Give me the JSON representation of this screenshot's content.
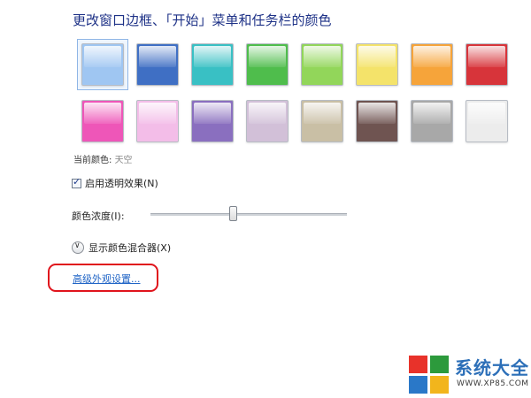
{
  "title": "更改窗口边框、「开始」菜单和任务栏的颜色",
  "swatches": [
    {
      "name": "sky",
      "color": "#9fc6f2",
      "selected": true
    },
    {
      "name": "twilight",
      "color": "#3f6fc4"
    },
    {
      "name": "sea",
      "color": "#39c0c4"
    },
    {
      "name": "leaf",
      "color": "#4fbd4c"
    },
    {
      "name": "lime",
      "color": "#92d65a"
    },
    {
      "name": "sun",
      "color": "#f4e36a"
    },
    {
      "name": "pumpkin",
      "color": "#f6a43a"
    },
    {
      "name": "ruby",
      "color": "#d7343a"
    },
    {
      "name": "fuchsia",
      "color": "#ee56b8"
    },
    {
      "name": "blush",
      "color": "#f3bde8"
    },
    {
      "name": "violet",
      "color": "#8a6fbf"
    },
    {
      "name": "lavender",
      "color": "#d2c0d8"
    },
    {
      "name": "taupe",
      "color": "#c9bfa5"
    },
    {
      "name": "chocolate",
      "color": "#6f5451"
    },
    {
      "name": "slate",
      "color": "#a8a8a8"
    },
    {
      "name": "frost",
      "color": "#ececec"
    }
  ],
  "current": {
    "label": "当前颜色:",
    "value": "天空"
  },
  "transparency": {
    "label": "启用透明效果(N)",
    "checked": true
  },
  "intensity": {
    "label": "颜色浓度(I):",
    "value_percent": 42
  },
  "mixer": {
    "label": "显示颜色混合器(X)"
  },
  "advanced_link": "高级外观设置...",
  "watermark": {
    "brand": "系统大全",
    "site": "WWW.XP85.COM",
    "colors": [
      "#e8322a",
      "#2c9a3c",
      "#2a78c8",
      "#f2b51c"
    ]
  }
}
